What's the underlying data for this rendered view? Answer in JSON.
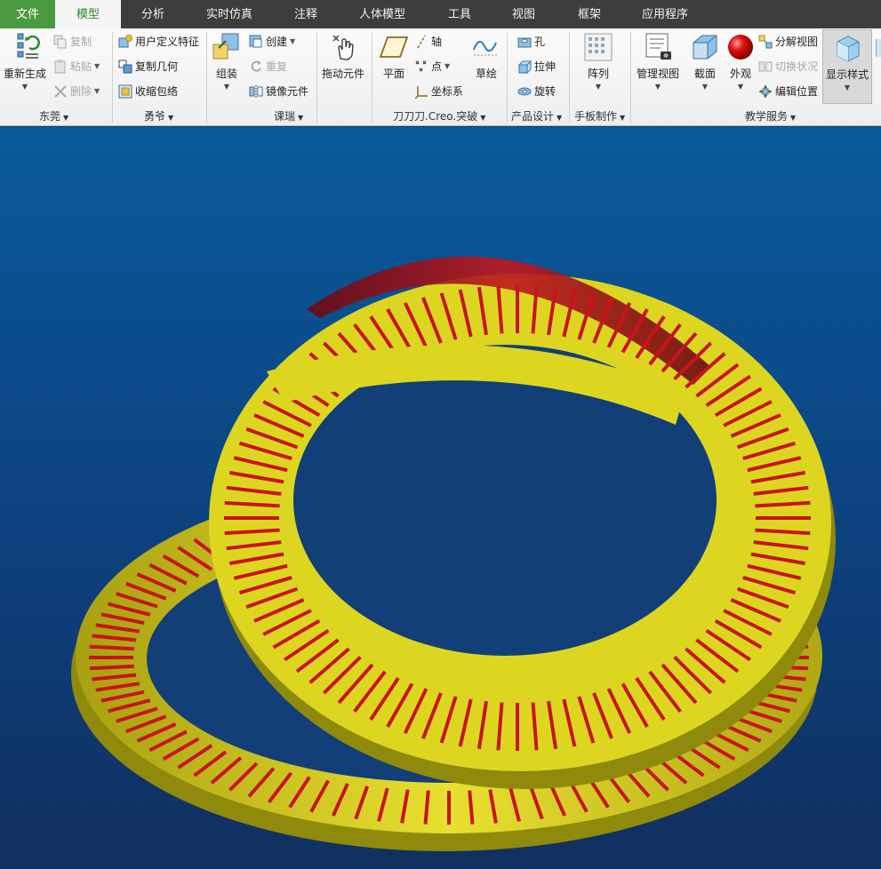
{
  "tabs": [
    {
      "label": "文件",
      "kind": "file"
    },
    {
      "label": "模型",
      "kind": "active"
    },
    {
      "label": "分析"
    },
    {
      "label": "实时仿真"
    },
    {
      "label": "注释"
    },
    {
      "label": "人体模型"
    },
    {
      "label": "工具"
    },
    {
      "label": "视图"
    },
    {
      "label": "框架"
    },
    {
      "label": "应用程序"
    }
  ],
  "groups": {
    "g1": {
      "label": "东莞",
      "regenerate": "重新生成",
      "copy": "复制",
      "paste": "粘贴",
      "delete": "删除"
    },
    "g2": {
      "label": "勇爷",
      "udf": "用户定义特征",
      "copy_geometry": "复制几何",
      "shrinkwrap": "收缩包络"
    },
    "g3": {
      "label": "课瑞",
      "assemble": "组装",
      "create": "创建",
      "repeat": "重复",
      "mirror": "镜像元件",
      "drag": "拖动元件"
    },
    "g4": {
      "label": "刀刀刀.Creo.突破",
      "plane": "平面",
      "axis": "轴",
      "point": "点",
      "csys": "坐标系",
      "sketch": "草绘"
    },
    "g5": {
      "label": "产品设计",
      "hole": "孔",
      "extrude": "拉伸",
      "revolve": "旋转"
    },
    "g6": {
      "label": "手板制作",
      "pattern": "阵列"
    },
    "g7": {
      "label": "教学服务",
      "manage_views": "管理视图",
      "section": "截面",
      "appearance": "外观",
      "exploded": "分解视图",
      "toggle_status": "切换状况",
      "edit_position": "编辑位置",
      "display_style": "显示样式"
    }
  },
  "colors": {
    "ring_yellow": "#d8d21a",
    "slot_red": "#c8141a",
    "background": "#0b4d8c",
    "active_tab_text": "#2f8a2f"
  }
}
